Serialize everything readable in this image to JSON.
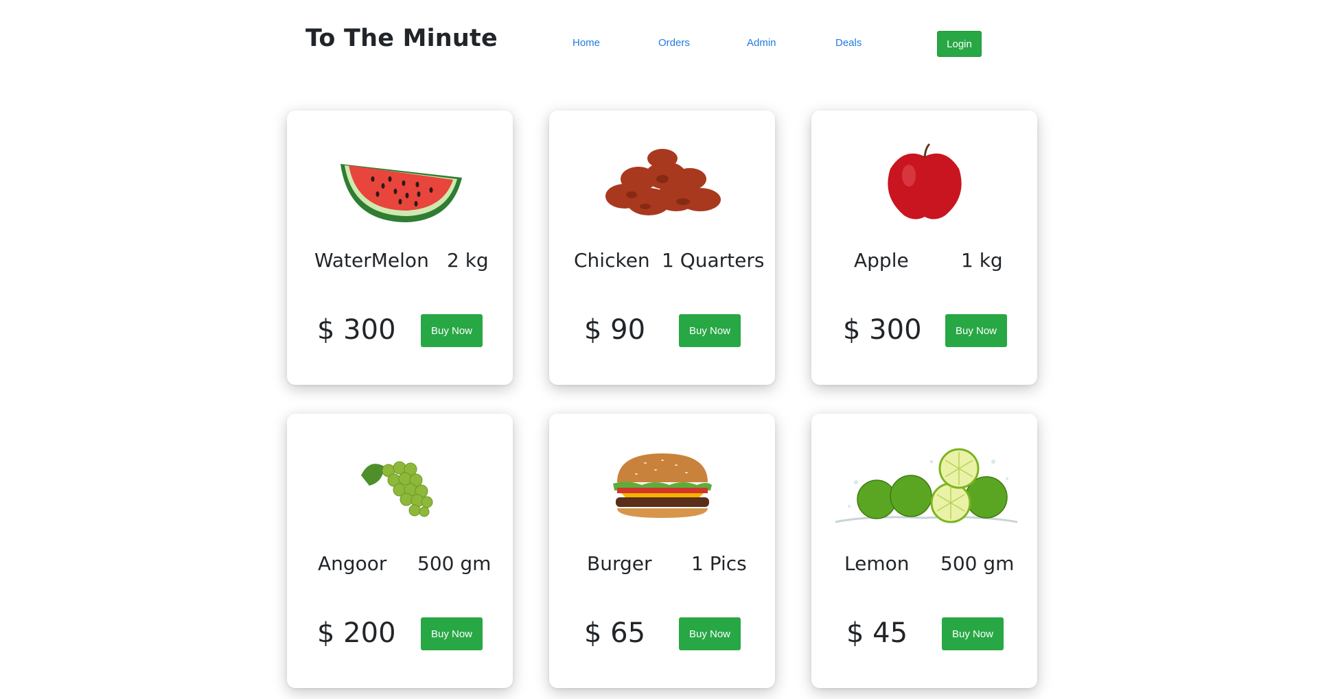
{
  "nav": {
    "brand": "To The Minute",
    "links": [
      "Home",
      "Orders",
      "Admin",
      "Deals"
    ],
    "login_label": "Login"
  },
  "colors": {
    "accent_green": "#28a745",
    "link_blue": "#1f7ae0"
  },
  "products": [
    {
      "name": "WaterMelon",
      "qty": "2 kg",
      "price": "$ 300",
      "button": "Buy Now",
      "image": "watermelon-image"
    },
    {
      "name": "Chicken",
      "qty": "1 Quarters",
      "price": "$ 90",
      "button": "Buy Now",
      "image": "chicken-wings-image"
    },
    {
      "name": "Apple",
      "qty": "1 kg",
      "price": "$ 300",
      "button": "Buy Now",
      "image": "apple-image"
    },
    {
      "name": "Angoor",
      "qty": "500 gm",
      "price": "$ 200",
      "button": "Buy Now",
      "image": "grapes-image"
    },
    {
      "name": "Burger",
      "qty": "1 Pics",
      "price": "$ 65",
      "button": "Buy Now",
      "image": "burger-image"
    },
    {
      "name": "Lemon",
      "qty": "500 gm",
      "price": "$ 45",
      "button": "Buy Now",
      "image": "limes-image"
    }
  ]
}
